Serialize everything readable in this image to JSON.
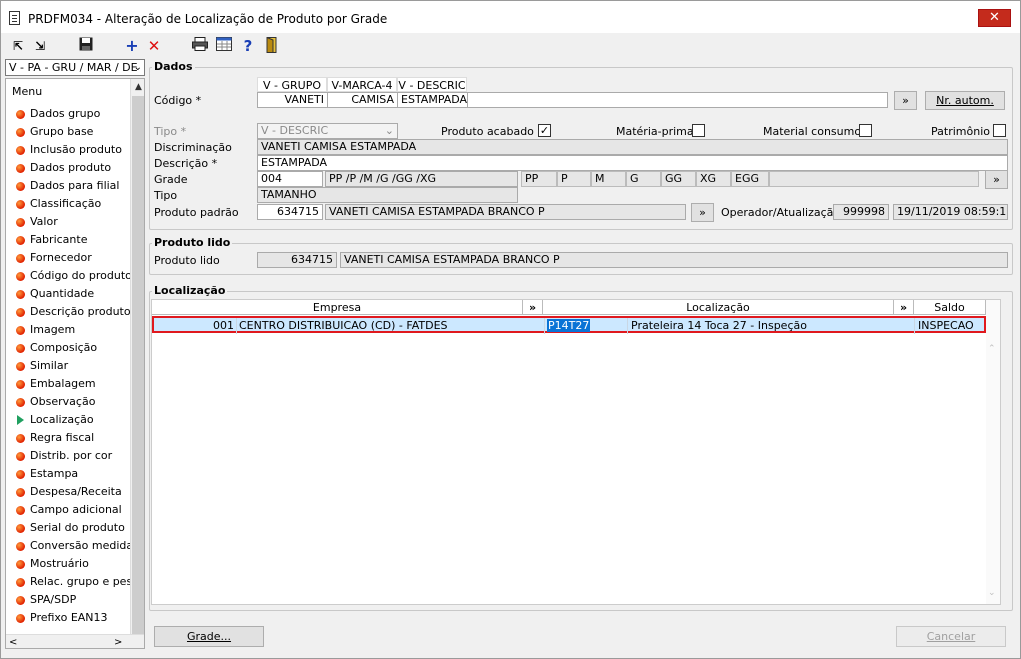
{
  "window": {
    "title": "PRDFM034 - Alteração de Localização de Produto por Grade",
    "close_label": "✕"
  },
  "toolbar": {
    "items": [
      "first-icon",
      "last-icon",
      "save-icon",
      "add-icon",
      "delete-icon",
      "print-icon",
      "calculator-icon",
      "help-icon",
      "exit-icon"
    ]
  },
  "sidebar": {
    "selector": "V - PA - GRU / MAR / DE",
    "menu_title": "Menu",
    "items": [
      {
        "label": "Dados grupo"
      },
      {
        "label": "Grupo base"
      },
      {
        "label": "Inclusão produto"
      },
      {
        "label": "Dados produto"
      },
      {
        "label": "Dados para filial"
      },
      {
        "label": "Classificação"
      },
      {
        "label": "Valor"
      },
      {
        "label": "Fabricante"
      },
      {
        "label": "Fornecedor"
      },
      {
        "label": "Código do produto"
      },
      {
        "label": "Quantidade"
      },
      {
        "label": "Descrição produto"
      },
      {
        "label": "Imagem"
      },
      {
        "label": "Composição"
      },
      {
        "label": "Similar"
      },
      {
        "label": "Embalagem"
      },
      {
        "label": "Observação"
      },
      {
        "label": "Localização",
        "active": true
      },
      {
        "label": "Regra fiscal"
      },
      {
        "label": "Distrib. por cor"
      },
      {
        "label": "Estampa"
      },
      {
        "label": "Despesa/Receita"
      },
      {
        "label": "Campo adicional"
      },
      {
        "label": "Serial do produto"
      },
      {
        "label": "Conversão medida"
      },
      {
        "label": "Mostruário"
      },
      {
        "label": "Relac. grupo e pess"
      },
      {
        "label": "SPA/SDP"
      },
      {
        "label": "Prefixo EAN13"
      }
    ]
  },
  "dados": {
    "title": "Dados",
    "codigo_headers": [
      "V - GRUPO",
      "V-MARCA-4",
      "V - DESCRIC"
    ],
    "codigo_label": "Código *",
    "codigo_values": [
      "VANETI",
      "CAMISA",
      "ESTAMPADA"
    ],
    "more_button": "»",
    "nr_autom_button": "Nr. autom.",
    "tipo_label": "Tipo *",
    "tipo_value": "V - DESCRIC",
    "produto_acabado_label": "Produto acabado",
    "produto_acabado_checked": true,
    "materia_prima_label": "Matéria-prima",
    "material_consumo_label": "Material consumo",
    "patrimonio_label": "Patrimônio",
    "check_mark": "✓",
    "discriminacao_label": "Discriminação",
    "discriminacao_value": "VANETI CAMISA ESTAMPADA",
    "descricao_label": "Descrição *",
    "descricao_value": "ESTAMPADA",
    "grade_label": "Grade",
    "grade_code": "004",
    "grade_desc": "PP /P /M /G /GG /XG",
    "grade_sizes": [
      "PP",
      "P",
      "M",
      "G",
      "GG",
      "XG",
      "EGG"
    ],
    "tipo2_label": "Tipo",
    "tipo2_value": "TAMANHO",
    "produto_padrao_label": "Produto padrão",
    "produto_padrao_code": "634715",
    "produto_padrao_desc": "VANETI CAMISA ESTAMPADA BRANCO P",
    "operador_label": "Operador/Atualização",
    "operador_value": "999998",
    "atualizacao_value": "19/11/2019 08:59:10"
  },
  "produto_lido": {
    "title": "Produto lido",
    "label": "Produto lido",
    "code": "634715",
    "desc": "VANETI CAMISA ESTAMPADA BRANCO P"
  },
  "localizacao": {
    "title": "Localização",
    "headers": {
      "empresa": "Empresa",
      "localizacao": "Localização",
      "saldo": "Saldo",
      "more": "»"
    },
    "rows": [
      {
        "empresa_code": "001",
        "empresa_name": "CENTRO DISTRIBUICAO (CD) - FATDES",
        "loc_code": "P14T27",
        "loc_desc": "Prateleira 14 Toca 27 - Inspeção",
        "saldo": "INSPECAO"
      }
    ]
  },
  "footer": {
    "grade_button": "Grade...",
    "cancelar_button": "Cancelar"
  }
}
